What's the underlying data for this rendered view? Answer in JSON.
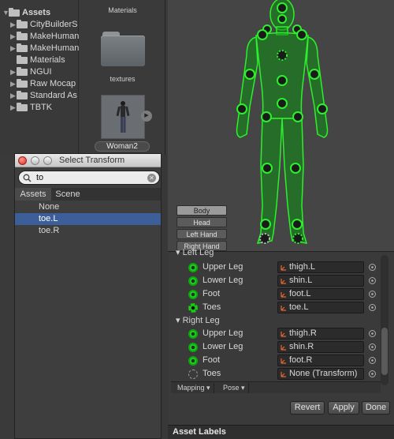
{
  "project_tree": {
    "items": [
      {
        "label": "Assets",
        "expanded": true,
        "bold": true
      },
      {
        "label": "CityBuilderS",
        "expanded": false
      },
      {
        "label": "MakeHuman",
        "expanded": false
      },
      {
        "label": "MakeHuman",
        "expanded": false
      },
      {
        "label": "Materials",
        "expanded": null
      },
      {
        "label": "NGUI",
        "expanded": false
      },
      {
        "label": "Raw Mocap",
        "expanded": false
      },
      {
        "label": "Standard As",
        "expanded": false
      },
      {
        "label": "TBTK",
        "expanded": false
      }
    ]
  },
  "asset_grid": {
    "materials_label": "Materials",
    "textures_label": "textures",
    "selected_asset_label": "Woman2"
  },
  "scene": {
    "buttons": [
      "Body",
      "Head",
      "Left Hand",
      "Right Hand"
    ],
    "active_button": "Body",
    "accent_color": "#1ed41e"
  },
  "dialog": {
    "title": "Select Transform",
    "search_value": "to",
    "tabs": [
      "Assets",
      "Scene"
    ],
    "selected_tab": "Assets",
    "items": [
      {
        "label": "None",
        "selected": false
      },
      {
        "label": "toe.L",
        "selected": true
      },
      {
        "label": "toe.R",
        "selected": false
      }
    ]
  },
  "inspector": {
    "left_leg": {
      "header": "Left Leg",
      "rows": [
        {
          "label": "Upper Leg",
          "value": "thigh.L",
          "icon": "solid"
        },
        {
          "label": "Lower Leg",
          "value": "shin.L",
          "icon": "solid"
        },
        {
          "label": "Foot",
          "value": "foot.L",
          "icon": "solid"
        },
        {
          "label": "Toes",
          "value": "toe.L",
          "icon": "dotted"
        }
      ]
    },
    "right_leg": {
      "header": "Right Leg",
      "rows": [
        {
          "label": "Upper Leg",
          "value": "thigh.R",
          "icon": "solid"
        },
        {
          "label": "Lower Leg",
          "value": "shin.R",
          "icon": "solid"
        },
        {
          "label": "Foot",
          "value": "foot.R",
          "icon": "solid"
        },
        {
          "label": "Toes",
          "value": "None (Transform)",
          "icon": "empty"
        }
      ]
    },
    "toolbar": {
      "mapping": "Mapping ▾",
      "pose": "Pose ▾"
    },
    "revert_label": "Revert",
    "apply_label": "Apply",
    "done_label": "Done"
  },
  "asset_labels_title": "Asset Labels"
}
